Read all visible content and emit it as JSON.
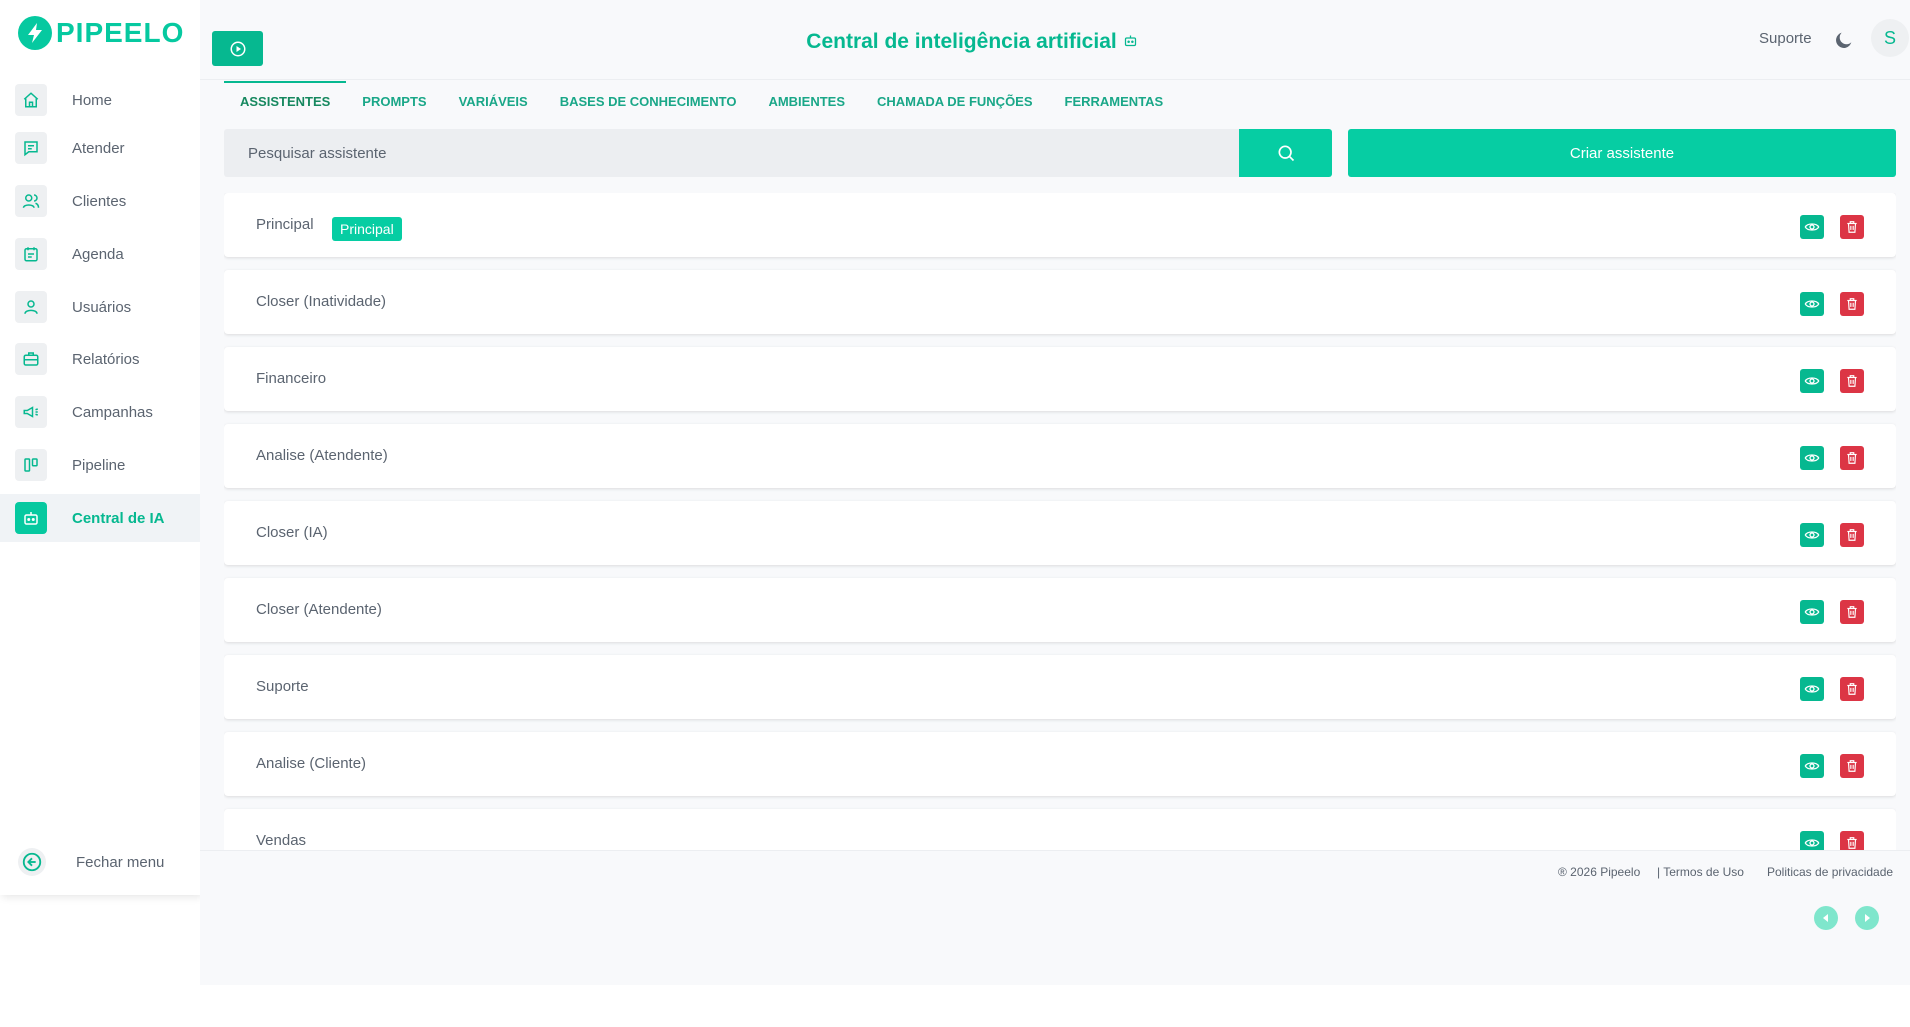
{
  "brand": {
    "name": "PIPEELO"
  },
  "sidebar": {
    "items": [
      {
        "label": "Home",
        "icon": "home-icon"
      },
      {
        "label": "Atender",
        "icon": "message-icon"
      },
      {
        "label": "Clientes",
        "icon": "users-icon"
      },
      {
        "label": "Agenda",
        "icon": "calendar-icon"
      },
      {
        "label": "Usuários",
        "icon": "user-icon"
      },
      {
        "label": "Relatórios",
        "icon": "briefcase-icon"
      },
      {
        "label": "Campanhas",
        "icon": "megaphone-icon"
      },
      {
        "label": "Pipeline",
        "icon": "kanban-icon"
      },
      {
        "label": "Central de IA",
        "icon": "robot-icon",
        "active": true
      }
    ],
    "close_label": "Fechar menu"
  },
  "header": {
    "title": "Central de inteligência artificial",
    "support_label": "Suporte",
    "avatar_initial": "S"
  },
  "tabs": [
    {
      "label": "ASSISTENTES",
      "active": true
    },
    {
      "label": "PROMPTS"
    },
    {
      "label": "VARIÁVEIS"
    },
    {
      "label": "BASES DE CONHECIMENTO"
    },
    {
      "label": "AMBIENTES"
    },
    {
      "label": "CHAMADA DE FUNÇÕES"
    },
    {
      "label": "FERRAMENTAS"
    }
  ],
  "search": {
    "placeholder": "Pesquisar assistente",
    "value": ""
  },
  "create_button_label": "Criar assistente",
  "assistants": [
    {
      "name": "Principal",
      "badge": "Principal"
    },
    {
      "name": "Closer (Inatividade)"
    },
    {
      "name": "Financeiro"
    },
    {
      "name": "Analise (Atendente)"
    },
    {
      "name": "Closer (IA)"
    },
    {
      "name": "Closer (Atendente)"
    },
    {
      "name": "Suporte"
    },
    {
      "name": "Analise (Cliente)"
    },
    {
      "name": "Vendas"
    }
  ],
  "footer": {
    "copyright": "® 2026 Pipeelo",
    "terms": "| Termos de Uso",
    "privacy": "Politicas de privacidade"
  },
  "colors": {
    "accent": "#06cda3",
    "accent_dark": "#06b890",
    "danger": "#dc3545",
    "text": "#5b6470"
  }
}
